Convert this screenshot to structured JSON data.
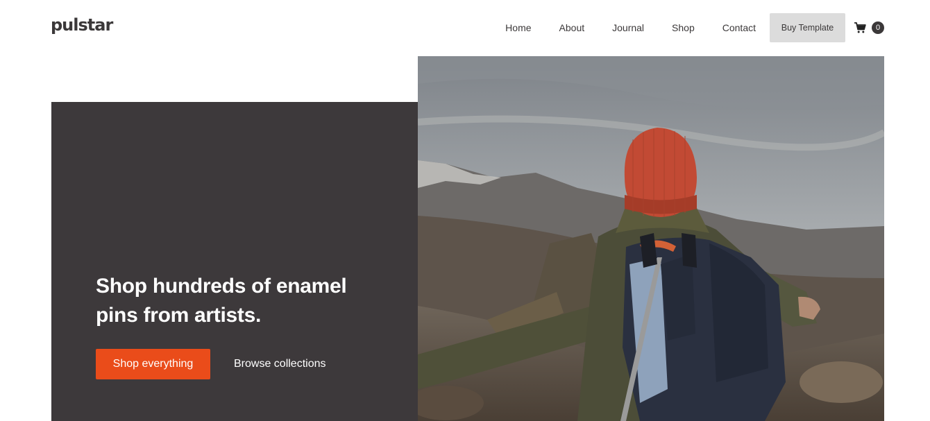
{
  "brand": {
    "logo_text": "pulstar"
  },
  "nav": {
    "items": [
      {
        "label": "Home"
      },
      {
        "label": "About"
      },
      {
        "label": "Journal"
      },
      {
        "label": "Shop"
      },
      {
        "label": "Contact"
      }
    ],
    "buy_label": "Buy Template",
    "cart_count": "0"
  },
  "hero": {
    "title": "Shop hundreds of enamel pins from artists.",
    "primary_cta": "Shop everything",
    "secondary_cta": "Browse collections",
    "image_subject": "hiker with red beanie and backpack on mountain ridge"
  },
  "colors": {
    "accent": "#ea4c1a",
    "panel": "#3d393b",
    "text": "#3b3839",
    "button_gray": "#dcdcdc"
  }
}
